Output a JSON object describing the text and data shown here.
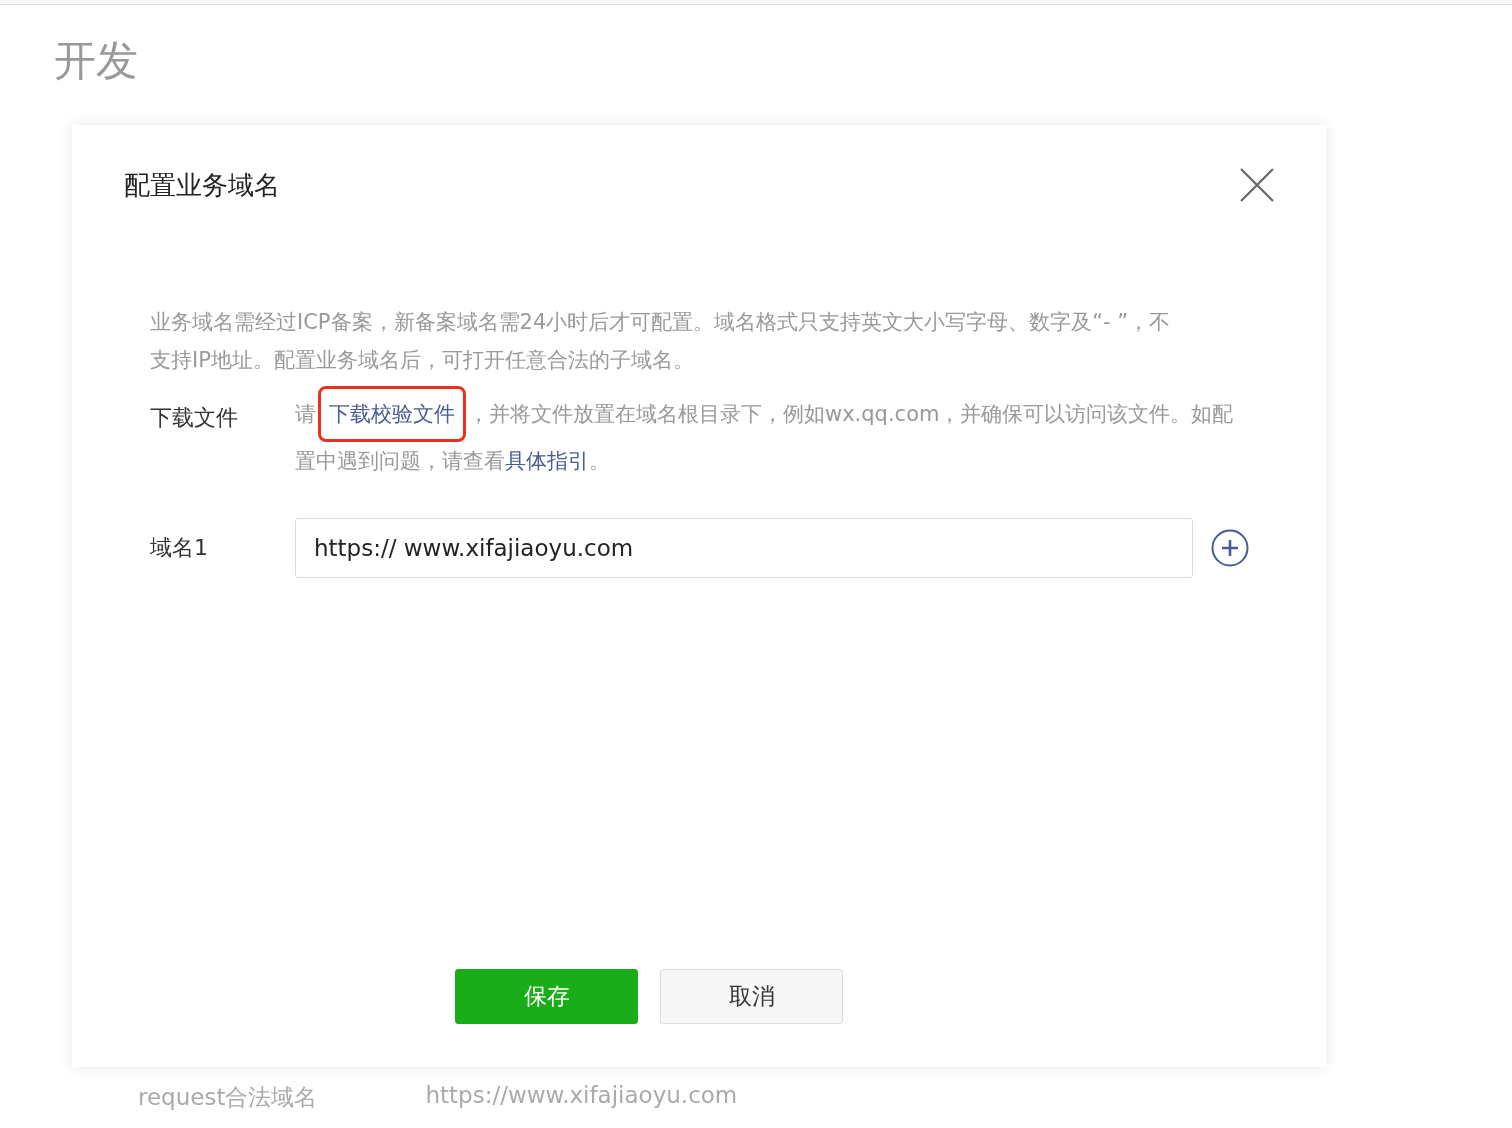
{
  "page": {
    "title": "开发"
  },
  "dialog": {
    "title": "配置业务域名",
    "description": "业务域名需经过ICP备案，新备案域名需24小时后才可配置。域名格式只支持英文大小写字母、数字及“- ”，不支持IP地址。配置业务域名后，可打开任意合法的子域名。",
    "download": {
      "label": "下载文件",
      "highlighted": true,
      "segments": [
        {
          "kind": "plain",
          "text": "请"
        },
        {
          "kind": "link",
          "text": "下载校验文件"
        },
        {
          "kind": "plain",
          "text": "，并将文件放置在域名根目录下，例如wx.qq.com，并确保可以访问该文件。如配置中遇到问题，请查看"
        },
        {
          "kind": "link",
          "text": "具体指引"
        },
        {
          "kind": "plain",
          "text": "。"
        }
      ]
    },
    "domains": [
      {
        "label": "域名1",
        "value": "https:// www.xifajiaoyu.com"
      }
    ],
    "buttons": [
      {
        "kind": "primary",
        "label": "保存"
      },
      {
        "kind": "default",
        "label": "取消"
      }
    ]
  },
  "background_row": {
    "name": "request合法域名",
    "value": "https://www.xifajiaoyu.com"
  }
}
